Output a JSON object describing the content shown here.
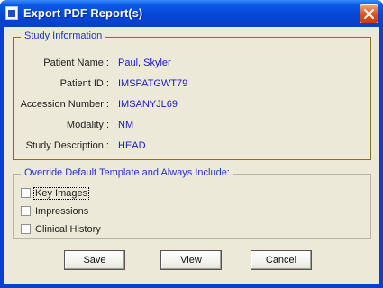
{
  "window": {
    "title": "Export PDF Report(s)"
  },
  "study": {
    "legend": "Study Information",
    "fields": [
      {
        "label": "Patient Name :",
        "value": "Paul, Skyler"
      },
      {
        "label": "Patient ID :",
        "value": "IMSPATGWT79"
      },
      {
        "label": "Accession Number :",
        "value": "IMSANYJL69"
      },
      {
        "label": "Modality :",
        "value": "NM"
      },
      {
        "label": "Study Description :",
        "value": "HEAD"
      }
    ]
  },
  "override": {
    "legend": "Override Default Template and Always Include:",
    "options": [
      {
        "label": "Key Images",
        "checked": false
      },
      {
        "label": "Impressions",
        "checked": false
      },
      {
        "label": "Clinical History",
        "checked": false
      }
    ]
  },
  "buttons": {
    "save": "Save",
    "view": "View",
    "cancel": "Cancel"
  },
  "colors": {
    "titlebar": "#0a5ae8",
    "legend_text": "#2233cc",
    "value_text": "#1a1acc",
    "close_button": "#e05a28",
    "dialog_bg": "#ece9d8"
  },
  "icons": {
    "app": "report-window-icon",
    "close": "close-icon"
  }
}
